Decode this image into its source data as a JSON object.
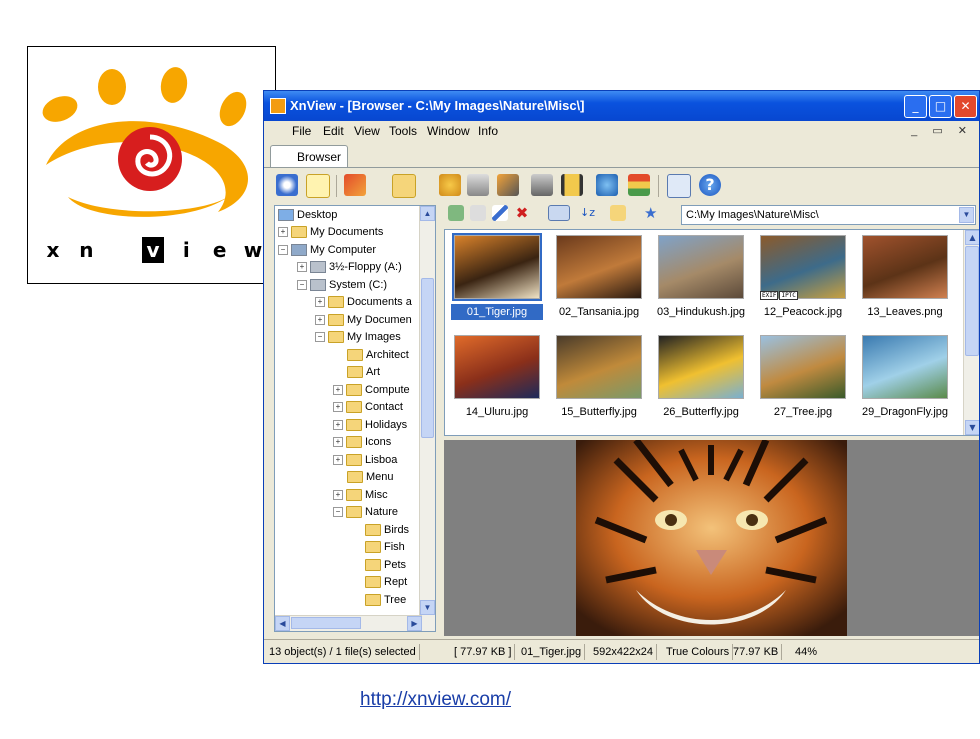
{
  "logo": {
    "letters": [
      "x",
      "n",
      "v",
      "i",
      "e",
      "w"
    ]
  },
  "window": {
    "title": "XnView - [Browser - C:\\My Images\\Nature\\Misc\\]",
    "controls": {
      "minimize": "_",
      "maximize": "□",
      "close": "✕"
    }
  },
  "menu": {
    "items": [
      "File",
      "Edit",
      "View",
      "Tools",
      "Window",
      "Info"
    ],
    "mdi": "_ ▭ ✕"
  },
  "tabs": [
    {
      "label": "Browser"
    }
  ],
  "tree": {
    "items": [
      {
        "label": "Desktop",
        "kind": "desktop"
      },
      {
        "label": "My Documents",
        "kind": "folder",
        "expander": "+"
      },
      {
        "label": "My Computer",
        "kind": "computer",
        "expander": "−"
      },
      {
        "label": "3½-Floppy (A:)",
        "kind": "drive",
        "expander": "+"
      },
      {
        "label": "System (C:)",
        "kind": "drive",
        "expander": "−"
      },
      {
        "label": "Documents a",
        "kind": "folder",
        "expander": "+"
      },
      {
        "label": "My Documen",
        "kind": "folder",
        "expander": "+"
      },
      {
        "label": "My Images",
        "kind": "folder",
        "expander": "−"
      },
      {
        "label": "Architect",
        "kind": "folder"
      },
      {
        "label": "Art",
        "kind": "folder"
      },
      {
        "label": "Compute",
        "kind": "folder",
        "expander": "+"
      },
      {
        "label": "Contact",
        "kind": "folder",
        "expander": "+"
      },
      {
        "label": "Holidays",
        "kind": "folder",
        "expander": "+"
      },
      {
        "label": "Icons",
        "kind": "folder",
        "expander": "+"
      },
      {
        "label": "Lisboa",
        "kind": "folder",
        "expander": "+"
      },
      {
        "label": "Menu",
        "kind": "folder"
      },
      {
        "label": "Misc",
        "kind": "folder",
        "expander": "+"
      },
      {
        "label": "Nature",
        "kind": "folder",
        "expander": "−"
      },
      {
        "label": "Birds",
        "kind": "folder"
      },
      {
        "label": "Fish",
        "kind": "folder"
      },
      {
        "label": "Pets",
        "kind": "folder"
      },
      {
        "label": "Rept",
        "kind": "folder"
      },
      {
        "label": "Tree",
        "kind": "folder"
      }
    ]
  },
  "address": {
    "value": "C:\\My Images\\Nature\\Misc\\"
  },
  "thumbnails": [
    {
      "name": "01_Tiger.jpg",
      "selected": true,
      "colors": [
        "#d9822b",
        "#3a2412",
        "#f0e2c4"
      ]
    },
    {
      "name": "02_Tansania.jpg",
      "colors": [
        "#6b3a1c",
        "#c07a3a",
        "#2a1a10"
      ]
    },
    {
      "name": "03_Hindukush.jpg",
      "colors": [
        "#7fa2c8",
        "#a58a68",
        "#5c4a3a"
      ]
    },
    {
      "name": "12_Peacock.jpg",
      "tags": [
        "EXIF",
        "IPTC"
      ],
      "colors": [
        "#8b5a2b",
        "#3d6b8a",
        "#c8a040"
      ]
    },
    {
      "name": "13_Leaves.png",
      "colors": [
        "#a0522d",
        "#5c3317",
        "#d08050"
      ]
    },
    {
      "name": "14_Uluru.jpg",
      "colors": [
        "#e06b2a",
        "#8a2f1a",
        "#1d2a5a"
      ]
    },
    {
      "name": "15_Butterfly.jpg",
      "colors": [
        "#4a3b2a",
        "#c08a3a",
        "#7a9a6a"
      ]
    },
    {
      "name": "26_Butterfly.jpg",
      "colors": [
        "#222222",
        "#f0c030",
        "#7ab0d0"
      ]
    },
    {
      "name": "27_Tree.jpg",
      "colors": [
        "#9ac0e0",
        "#c08a40",
        "#3a5a2a"
      ]
    },
    {
      "name": "29_DragonFly.jpg",
      "colors": [
        "#3a7ab0",
        "#a0d0e8",
        "#5a8a4a"
      ]
    }
  ],
  "status": {
    "objects": "13 object(s) / 1 file(s) selected",
    "size": "[ 77.97 KB ]",
    "file": "01_Tiger.jpg",
    "dims": "592x422x24",
    "colors": "True Colours",
    "filesize": "77.97 KB",
    "zoom": "44%"
  },
  "url": "http://xnview.com/"
}
